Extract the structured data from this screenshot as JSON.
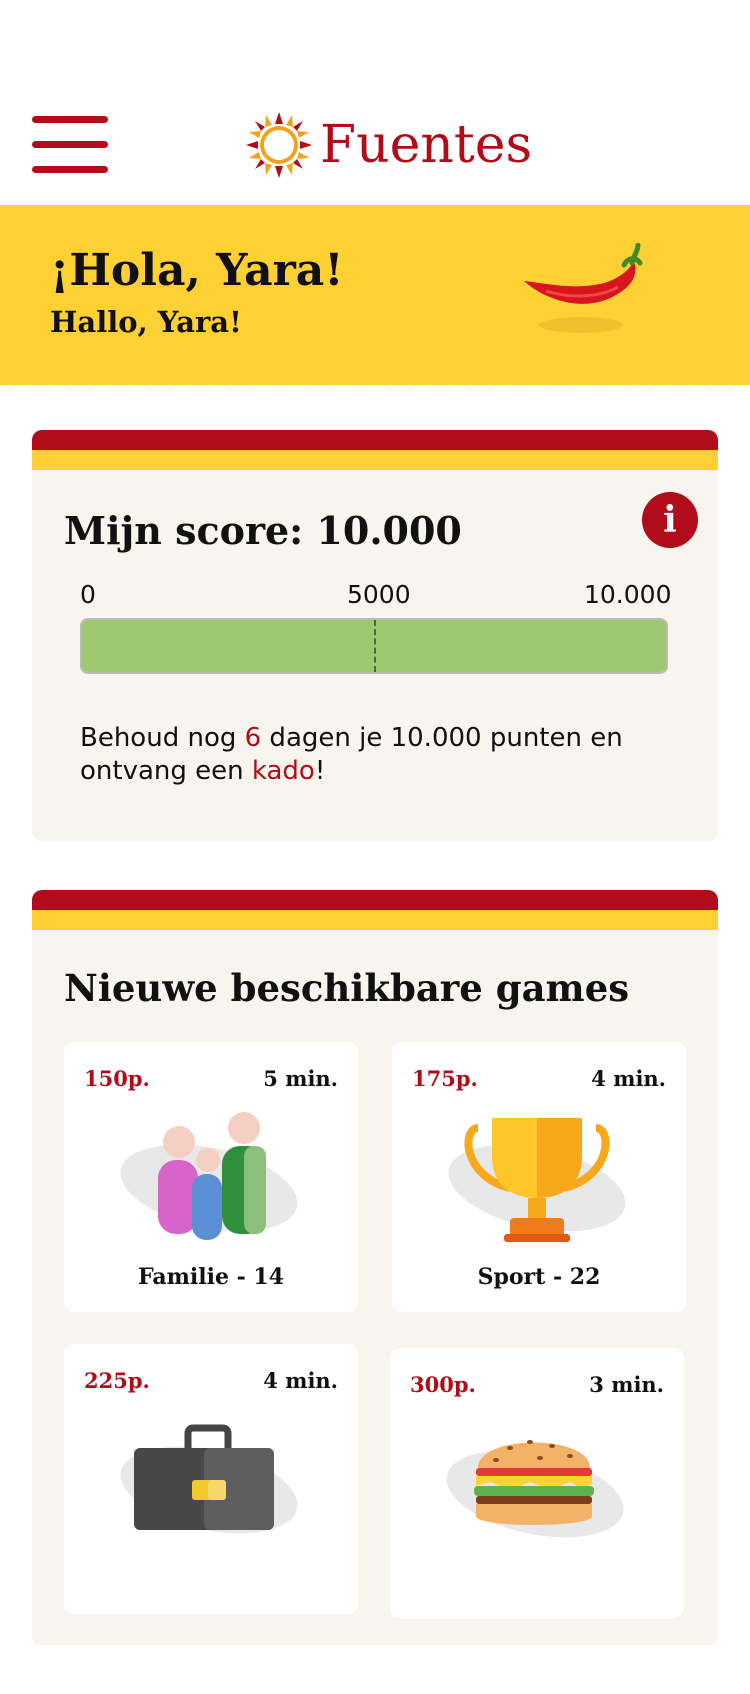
{
  "header": {
    "brand": "Fuentes"
  },
  "greeting": {
    "title": "¡Hola, Yara!",
    "subtitle": "Hallo, Yara!"
  },
  "score": {
    "title": "Mijn score: 10.000",
    "info_label": "i",
    "ticks": [
      "0",
      "5000",
      "10.000"
    ],
    "progress_fraction": 1.0,
    "message_part1": "Behoud nog ",
    "days": "6",
    "message_part2": " dagen je 10.000 punten en ontvang een ",
    "gift": "kado",
    "message_part3": "!"
  },
  "games": {
    "title": "Nieuwe beschikbare games",
    "items": [
      {
        "points": "150p.",
        "duration": "5 min.",
        "name": "Familie - 14",
        "icon": "family-icon"
      },
      {
        "points": "175p.",
        "duration": "4 min.",
        "name": "Sport - 22",
        "icon": "trophy-icon"
      },
      {
        "points": "225p.",
        "duration": "4 min.",
        "name": "",
        "icon": "briefcase-icon"
      },
      {
        "points": "300p.",
        "duration": "3 min.",
        "name": "",
        "icon": "burger-icon"
      }
    ]
  },
  "colors": {
    "brand_red": "#b10c1a",
    "brand_yellow": "#fdd033",
    "progress_green": "#9ec86e",
    "card_bg": "#f8f5ee"
  }
}
